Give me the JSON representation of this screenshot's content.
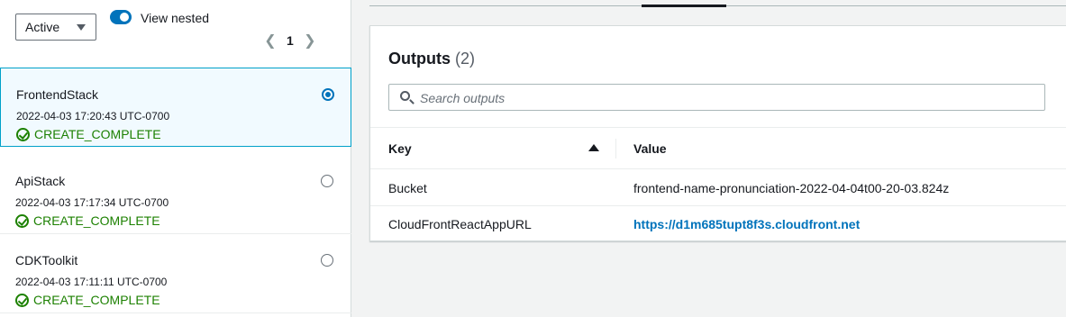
{
  "filter": {
    "selected": "Active"
  },
  "view_nested": {
    "label": "View nested",
    "enabled": true
  },
  "pagination": {
    "current_page": "1"
  },
  "stacks": [
    {
      "name": "FrontendStack",
      "timestamp": "2022-04-03 17:20:43 UTC-0700",
      "status": "CREATE_COMPLETE",
      "selected": true
    },
    {
      "name": "ApiStack",
      "timestamp": "2022-04-03 17:17:34 UTC-0700",
      "status": "CREATE_COMPLETE",
      "selected": false
    },
    {
      "name": "CDKToolkit",
      "timestamp": "2022-04-03 17:11:11 UTC-0700",
      "status": "CREATE_COMPLETE",
      "selected": false
    }
  ],
  "outputs": {
    "title": "Outputs",
    "count": "(2)",
    "search_placeholder": "Search outputs",
    "columns": {
      "key": "Key",
      "value": "Value"
    },
    "rows": [
      {
        "key": "Bucket",
        "value": "frontend-name-pronunciation-2022-04-04t00-20-03.824z"
      },
      {
        "key": "CloudFrontReactAppURL",
        "value": "https://d1m685tupt8f3s.cloudfront.net"
      }
    ]
  },
  "colors": {
    "accent": "#0073bb",
    "success": "#1d8102",
    "selected_bg": "#f1faff"
  }
}
